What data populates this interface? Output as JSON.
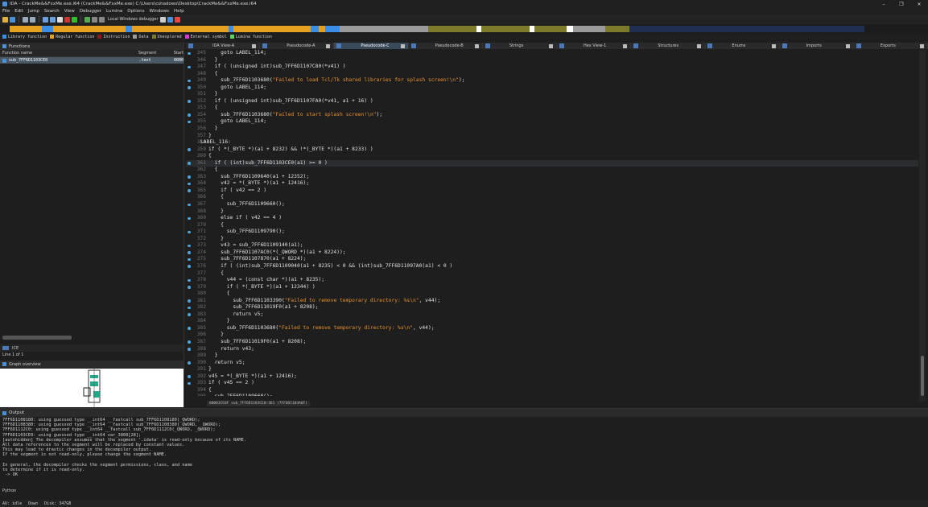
{
  "window": {
    "title": "IDA - CrackMe&&FxxMe.exe.i64 (CrackMe&&FxxMe.exe) C:\\Users\\cshadows\\Desktop\\CrackMe&&FxxMe.exe.i64"
  },
  "menu": [
    "File",
    "Edit",
    "Jump",
    "Search",
    "View",
    "Debugger",
    "Lumina",
    "Options",
    "Windows",
    "Help"
  ],
  "toolbar": {
    "debugger": "Local Windows debugger"
  },
  "legend": [
    {
      "label": "Library function",
      "color": "#3a8ee6"
    },
    {
      "label": "Regular function",
      "color": "#e6a020"
    },
    {
      "label": "Instruction",
      "color": "#8b1a1a"
    },
    {
      "label": "Data",
      "color": "#9a9a9a"
    },
    {
      "label": "Unexplored",
      "color": "#7b7b2b"
    },
    {
      "label": "External symbol",
      "color": "#d63ad6"
    },
    {
      "label": "Lumina function",
      "color": "#5ad65a"
    }
  ],
  "functions": {
    "title": "Functions",
    "col_name": "Function name",
    "col_segment": "Segment",
    "col_start": "Start",
    "row": {
      "name": "sub_7FF6D1103CE0",
      "segment": ".text",
      "start": "0000"
    }
  },
  "left_lower": {
    "ice": "ICE",
    "line_of": "Line 1 of 1",
    "graph_overview": "Graph overview"
  },
  "tabs": [
    "IDA View-A",
    "Pseudocode-A",
    "Pseudocode-C",
    "Pseudocode-B",
    "Strings",
    "Hex View-1",
    "Structures",
    "Enums",
    "Imports",
    "Exports"
  ],
  "active_tab": "Pseudocode-C",
  "code_lines": [
    {
      "ln": "345",
      "dot": true,
      "t": "    goto LABEL_114;"
    },
    {
      "ln": "346",
      "dot": false,
      "t": "  }"
    },
    {
      "ln": "347",
      "dot": true,
      "t": "  if ( (unsigned int)sub_7FF6D1107C80(*v41) )"
    },
    {
      "ln": "348",
      "dot": false,
      "t": "  {"
    },
    {
      "ln": "349",
      "dot": true,
      "t": "    sub_7FF6D1103680(",
      "s": "\"Failed to load Tcl/Tk shared libraries for splash screen!\\n\"",
      "e": ");"
    },
    {
      "ln": "350",
      "dot": true,
      "t": "    goto LABEL_114;"
    },
    {
      "ln": "351",
      "dot": false,
      "t": "  }"
    },
    {
      "ln": "352",
      "dot": true,
      "t": "  if ( (unsigned int)sub_7FF6D1107FA0(*v41, a1 + 16) )"
    },
    {
      "ln": "353",
      "dot": false,
      "t": "  {"
    },
    {
      "ln": "354",
      "dot": true,
      "t": "    sub_7FF6D1103680(",
      "s": "\"Failed to start splash screen!\\n\"",
      "e": ");"
    },
    {
      "ln": "355",
      "dot": true,
      "t": "    goto LABEL_114;"
    },
    {
      "ln": "356",
      "dot": false,
      "t": "  }"
    },
    {
      "ln": "357",
      "dot": false,
      "t": "}"
    },
    {
      "ln": "358",
      "dot": false,
      "t": "LABEL_116:",
      "label": true
    },
    {
      "ln": "359",
      "dot": true,
      "t": "if ( *(_BYTE *)(a1 + 8232) && !*(_BYTE *)(a1 + 8233) )"
    },
    {
      "ln": "360",
      "dot": false,
      "t": "{"
    },
    {
      "ln": "361",
      "dot": true,
      "t": "  if ( (int)sub_7FF6D1103CE0(a1) >= 0 )",
      "hl": true
    },
    {
      "ln": "362",
      "dot": false,
      "t": "  {"
    },
    {
      "ln": "363",
      "dot": true,
      "t": "    sub_7FF6D1109640(a1 + 12352);"
    },
    {
      "ln": "364",
      "dot": true,
      "t": "    v42 = *(_BYTE *)(a1 + 12416);"
    },
    {
      "ln": "365",
      "dot": true,
      "t": "    if ( v42 == 2 )"
    },
    {
      "ln": "366",
      "dot": false,
      "t": "    {"
    },
    {
      "ln": "367",
      "dot": true,
      "t": "      sub_7FF6D1109660();"
    },
    {
      "ln": "368",
      "dot": false,
      "t": "    }"
    },
    {
      "ln": "369",
      "dot": true,
      "t": "    else if ( v42 == 4 )"
    },
    {
      "ln": "370",
      "dot": false,
      "t": "    {"
    },
    {
      "ln": "371",
      "dot": true,
      "t": "      sub_7FF6D1109790();"
    },
    {
      "ln": "372",
      "dot": false,
      "t": "    }"
    },
    {
      "ln": "373",
      "dot": true,
      "t": "    v43 = sub_7FF6D1109140(a1);"
    },
    {
      "ln": "374",
      "dot": true,
      "t": "    sub_7FF6D1107AC0(*(_QWORD *)(a1 + 8224));"
    },
    {
      "ln": "375",
      "dot": true,
      "t": "    sub_7FF6D1107870(a1 + 8224);"
    },
    {
      "ln": "376",
      "dot": true,
      "t": "    if ( (int)sub_7FF6D1109040(a1 + 8235) < 0 && (int)sub_7FF6D11097A0(a1) < 0 )"
    },
    {
      "ln": "377",
      "dot": false,
      "t": "    {"
    },
    {
      "ln": "378",
      "dot": true,
      "t": "      v44 = (const char *)(a1 + 8235);"
    },
    {
      "ln": "379",
      "dot": true,
      "t": "      if ( *(_BYTE *)(a1 + 12344) )"
    },
    {
      "ln": "380",
      "dot": false,
      "t": "      {"
    },
    {
      "ln": "381",
      "dot": true,
      "t": "        sub_7FF6D1103390(",
      "s": "\"Failed to remove temporary directory: %s\\n\"",
      "e": ", v44);"
    },
    {
      "ln": "382",
      "dot": true,
      "t": "        sub_7FF6D11019F0(a1 + 8208);"
    },
    {
      "ln": "383",
      "dot": true,
      "t": "        return v5;"
    },
    {
      "ln": "384",
      "dot": false,
      "t": "      }"
    },
    {
      "ln": "385",
      "dot": true,
      "t": "      sub_7FF6D1103680(",
      "s": "\"Failed to remove temporary directory: %s\\n\"",
      "e": ", v44);"
    },
    {
      "ln": "386",
      "dot": false,
      "t": "    }"
    },
    {
      "ln": "387",
      "dot": true,
      "t": "    sub_7FF6D11019F0(a1 + 8208);"
    },
    {
      "ln": "388",
      "dot": true,
      "t": "    return v43;"
    },
    {
      "ln": "389",
      "dot": false,
      "t": "  }"
    },
    {
      "ln": "390",
      "dot": true,
      "t": "  return v5;"
    },
    {
      "ln": "391",
      "dot": false,
      "t": "}"
    },
    {
      "ln": "392",
      "dot": true,
      "t": "v45 = *(_BYTE *)(a1 + 12416);"
    },
    {
      "ln": "393",
      "dot": true,
      "t": "if ( v45 == 2 )"
    },
    {
      "ln": "394",
      "dot": false,
      "t": "{"
    },
    {
      "ln": "395",
      "dot": true,
      "t": "  sub_7FF6D1109660();"
    }
  ],
  "code_status": "00003CE0F sub_7FF6D1103CE0:361 (7FF6D1104A0F)",
  "output": {
    "title": "Output",
    "lines": [
      "7FF6D1108180: using guessed type __int64 __fastcall sub_7FF6D1108180(_QWORD);",
      "7FF6D1108380: using guessed type __int64 __fastcall sub_7FF6D1108380(_QWORD, _QWORD);",
      "7FF6D1112C0: using guessed type __int64 __fastcall sub_7FF6D1112C0(_QWORD, _QWORD);",
      "7FF6D1103CE0: using guessed type __int64 var_3808[28];",
      "[autohidden] The decompiler assumes that the segment '.idata' is read-only because of its NAME.",
      "All data references to the segment will be replaced by constant values.",
      "This may lead to drastic changes in the decompiler output.",
      "If the segment is not read-only, please change the segment NAME.",
      "",
      "In general, the decompiler checks the segment permissions, class, and name",
      "to determine if it is read-only.",
      " -> OK"
    ],
    "python": "Python"
  },
  "status": {
    "au": "AU:  idle",
    "down": "Down",
    "disk": "Disk: 347GB"
  }
}
